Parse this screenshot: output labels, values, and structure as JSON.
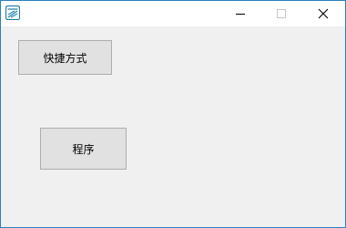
{
  "window": {
    "title": "",
    "icon": "app-icon",
    "controls": {
      "minimize_icon": "minimize-icon",
      "maximize_icon": "maximize-icon",
      "close_icon": "close-icon"
    }
  },
  "buttons": {
    "shortcut_label": "快捷方式",
    "program_label": "程序"
  },
  "colors": {
    "border": "#2b7fc2",
    "client_bg": "#f0f0f0",
    "button_bg": "#e1e1e1",
    "button_border": "#adadad",
    "icon_accent": "#1e7fa8"
  }
}
